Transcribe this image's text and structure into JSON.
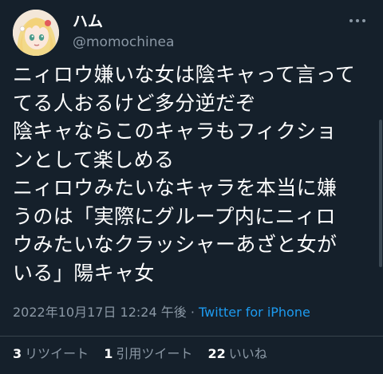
{
  "tweet": {
    "author": {
      "display_name": "ハム",
      "handle": "@momochinea",
      "avatar_icon": "avatar-anime-girl"
    },
    "lines": [
      "ニィロウ嫌いな女は陰キャって言って",
      "てる人おるけど多分逆だぞ",
      "陰キャならこのキャラもフィクショ",
      "ンとして楽しめる",
      "ニィロウみたいなキャラを本当に嫌",
      "うのは「実際にグループ内にニィロ",
      "ウみたいなクラッシャーあざと女が",
      "いる」陽キャ女"
    ],
    "timestamp": "2022年10月17日 12:24 午後",
    "separator": "·",
    "source": "Twitter for iPhone",
    "stats": [
      {
        "count": "3",
        "label": "リツイート"
      },
      {
        "count": "1",
        "label": "引用ツイート"
      },
      {
        "count": "22",
        "label": "いいね"
      }
    ]
  },
  "colors": {
    "background": "#15202b",
    "text": "#ffffff",
    "muted": "#8b98a5",
    "accent": "#1d9bf0",
    "divider": "#38444d"
  },
  "icons": {
    "more": "more-options-icon"
  }
}
